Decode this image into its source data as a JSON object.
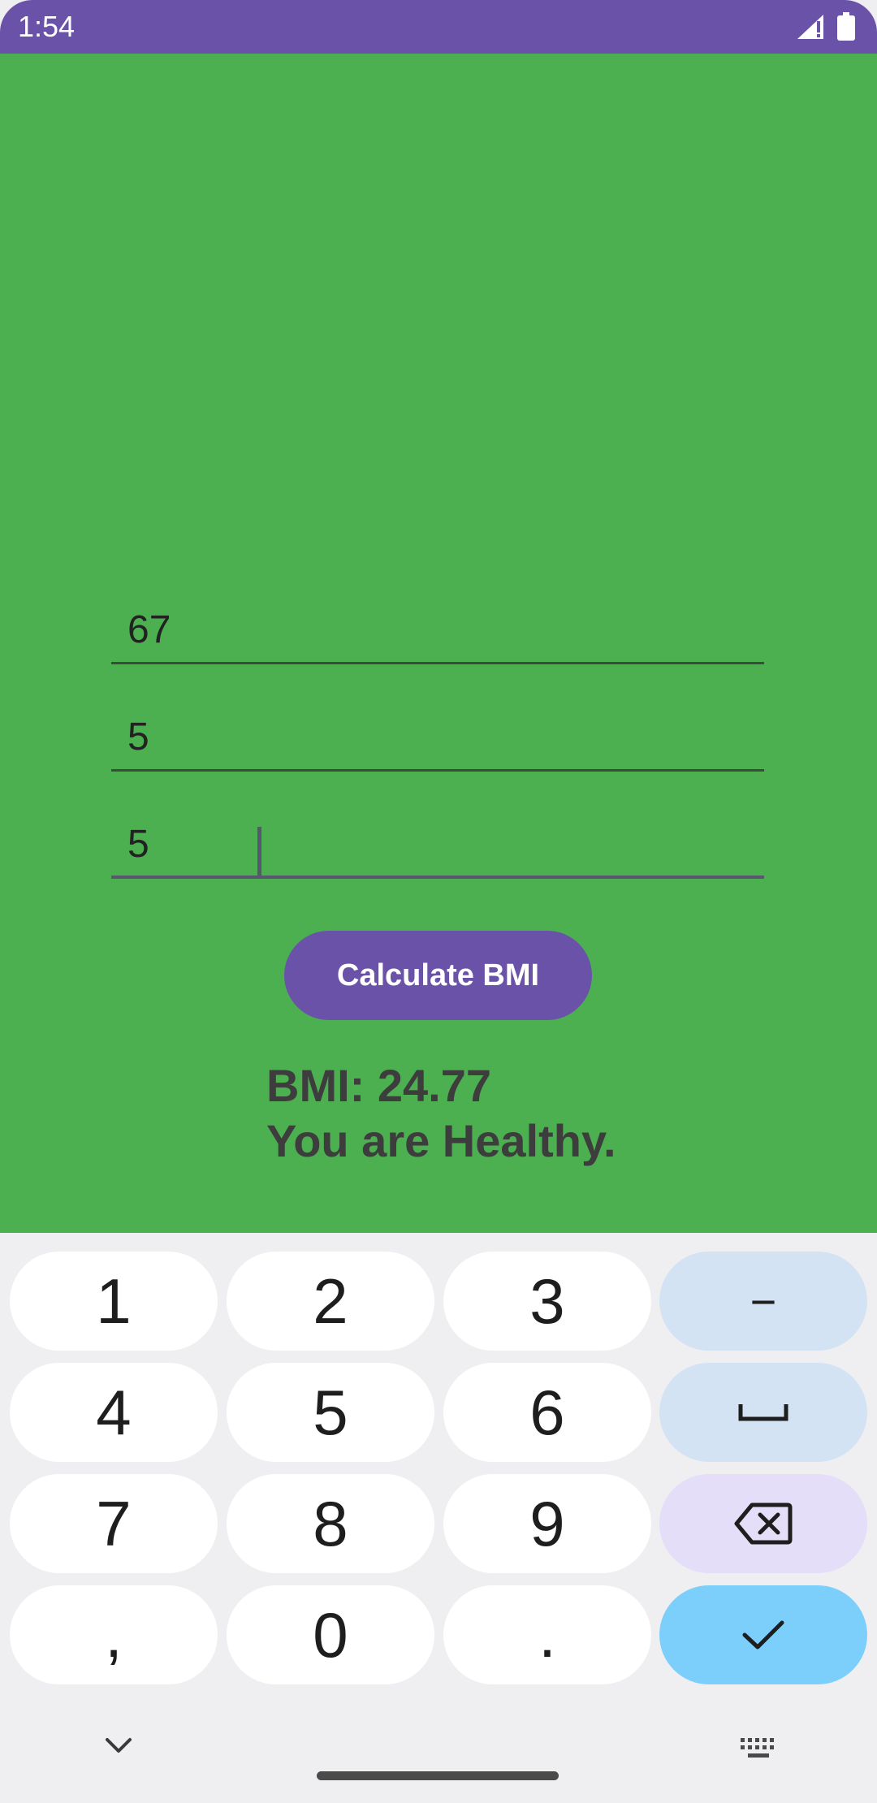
{
  "status_bar": {
    "time": "1:54",
    "icons": [
      "signal-icon",
      "battery-icon"
    ],
    "color": "#6a52a8"
  },
  "form": {
    "weight_value": "67",
    "height_feet_value": "5",
    "height_inches_value": "5",
    "calculate_label": "Calculate BMI"
  },
  "result": {
    "bmi_line": "BMI: 24.77",
    "status_line": "You are Healthy."
  },
  "keyboard": {
    "keys": {
      "k1": "1",
      "k2": "2",
      "k3": "3",
      "minus": "−",
      "k4": "4",
      "k5": "5",
      "k6": "6",
      "k7": "7",
      "k8": "8",
      "k9": "9",
      "comma": ",",
      "k0": "0",
      "period": "."
    },
    "function_icons": [
      "space-icon",
      "backspace-icon",
      "checkmark-icon"
    ]
  },
  "navigation": {
    "icons": [
      "chevron-down-icon",
      "keyboard-icon"
    ]
  },
  "colors": {
    "background": "#4caf50",
    "accent": "#6a52a8",
    "result_text": "#3d3d3d",
    "keyboard_bg": "#efeff1"
  }
}
